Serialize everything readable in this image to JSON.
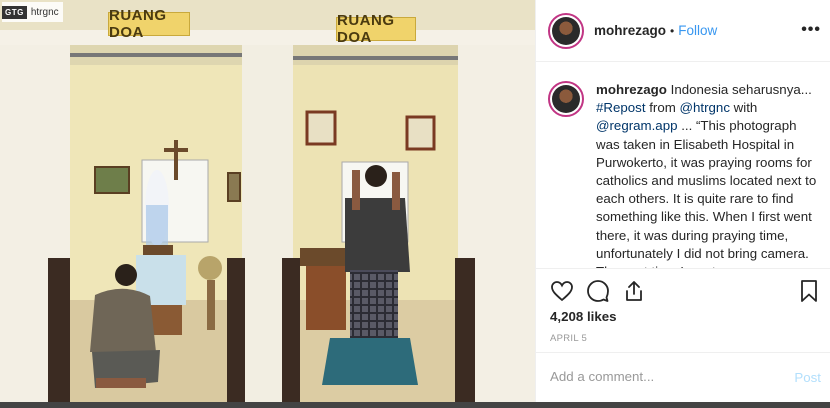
{
  "photo": {
    "watermark_logo": "GTG",
    "watermark_text": "htrgnc",
    "sign_left": "RUANG DOA",
    "sign_right": "RUANG DOA"
  },
  "header": {
    "username": "mohrezago",
    "separator": "•",
    "follow_label": "Follow",
    "more_label": "•••"
  },
  "caption": {
    "username": "mohrezago",
    "text_1": "Indonesia seharusnya... ",
    "hashtag": "#Repost",
    "text_2": " from ",
    "mention_1": "@htrgnc",
    "text_3": " with ",
    "mention_2": "@regram.app",
    "text_4": " ... “This photograph was taken in Elisabeth Hospital in Purwokerto, it was praying rooms for catholics and muslims located next to each others. It is quite rare to find something like this. When I first went there, it was during praying time, unfortunately I did not bring camera. The next time I went"
  },
  "actions": {
    "likes": "4,208 likes",
    "date": "APRIL 5"
  },
  "comment": {
    "placeholder": "Add a comment...",
    "post_label": "Post"
  },
  "colors": {
    "link": "#3897f0",
    "mention": "#003569",
    "post_disabled": "#b2dffc",
    "border": "#efefef"
  }
}
